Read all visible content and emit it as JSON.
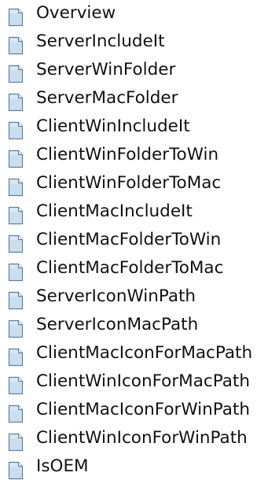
{
  "tree": {
    "items": [
      {
        "label": "Overview",
        "icon": "document-icon"
      },
      {
        "label": "ServerIncludeIt",
        "icon": "document-icon"
      },
      {
        "label": "ServerWinFolder",
        "icon": "document-icon"
      },
      {
        "label": "ServerMacFolder",
        "icon": "document-icon"
      },
      {
        "label": "ClientWinIncludeIt",
        "icon": "document-icon"
      },
      {
        "label": "ClientWinFolderToWin",
        "icon": "document-icon"
      },
      {
        "label": "ClientWinFolderToMac",
        "icon": "document-icon"
      },
      {
        "label": "ClientMacIncludeIt",
        "icon": "document-icon"
      },
      {
        "label": "ClientMacFolderToWin",
        "icon": "document-icon"
      },
      {
        "label": "ClientMacFolderToMac",
        "icon": "document-icon"
      },
      {
        "label": "ServerIconWinPath",
        "icon": "document-icon"
      },
      {
        "label": "ServerIconMacPath",
        "icon": "document-icon"
      },
      {
        "label": "ClientMacIconForMacPath",
        "icon": "document-icon"
      },
      {
        "label": "ClientWinIconForMacPath",
        "icon": "document-icon"
      },
      {
        "label": "ClientMacIconForWinPath",
        "icon": "document-icon"
      },
      {
        "label": "ClientWinIconForWinPath",
        "icon": "document-icon"
      },
      {
        "label": "IsOEM",
        "icon": "document-icon"
      }
    ],
    "colors": {
      "icon_fill": "#dbe8f3",
      "icon_stroke": "#5b7fa0",
      "text": "#111111"
    }
  }
}
